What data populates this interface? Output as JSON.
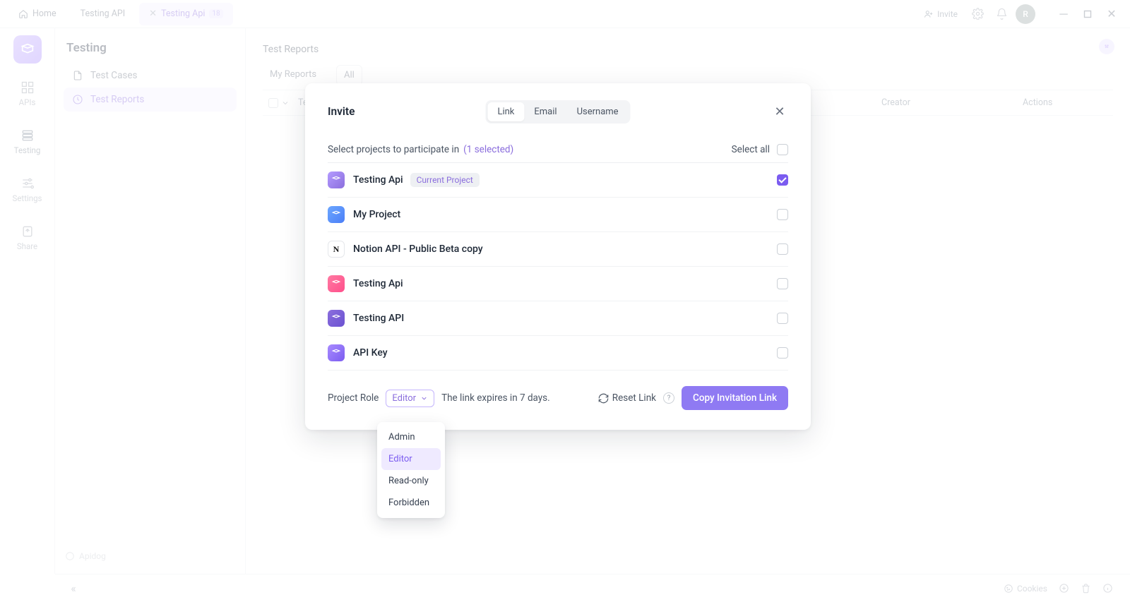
{
  "topbar": {
    "home": "Home",
    "tab_api": "Testing API",
    "tab_active": "Testing Api",
    "tab_badge": "18",
    "invite": "Invite",
    "avatar_letter": "R"
  },
  "rail": {
    "items": [
      {
        "label": "APIs"
      },
      {
        "label": "Testing"
      },
      {
        "label": "Settings"
      },
      {
        "label": "Share"
      }
    ]
  },
  "workspace": {
    "title": "Testing",
    "items": [
      {
        "label": "Test Cases"
      },
      {
        "label": "Test Reports"
      }
    ],
    "app_hint": "Apidog"
  },
  "page": {
    "title": "Test Reports",
    "tab_my": "My Reports",
    "tab_all": "All",
    "col_test": "Tests",
    "col_creator": "Creator",
    "col_actions": "Actions"
  },
  "footer": {
    "cookies": "Cookies"
  },
  "modal": {
    "title": "Invite",
    "seg_link": "Link",
    "seg_email": "Email",
    "seg_username": "Username",
    "select_text": "Select projects to participate in",
    "count_text": "(1 selected)",
    "select_all": "Select all",
    "current_badge": "Current Project",
    "projects": [
      {
        "name": "Testing Api",
        "icon": "p1",
        "checked": true,
        "current": true
      },
      {
        "name": "My Project",
        "icon": "p2",
        "checked": false,
        "current": false
      },
      {
        "name": "Notion API - Public Beta copy",
        "icon": "p3",
        "checked": false,
        "current": false,
        "icon_text": "N"
      },
      {
        "name": "Testing Api",
        "icon": "p4",
        "checked": false,
        "current": false
      },
      {
        "name": "Testing API",
        "icon": "p5",
        "checked": false,
        "current": false
      },
      {
        "name": "API Key",
        "icon": "p6",
        "checked": false,
        "current": false
      }
    ],
    "role_label": "Project Role",
    "role_selected": "Editor",
    "expire_text": "The link expires in 7 days.",
    "reset_text": "Reset Link",
    "copy_btn": "Copy Invitation Link",
    "role_options": [
      "Admin",
      "Editor",
      "Read-only",
      "Forbidden"
    ]
  }
}
